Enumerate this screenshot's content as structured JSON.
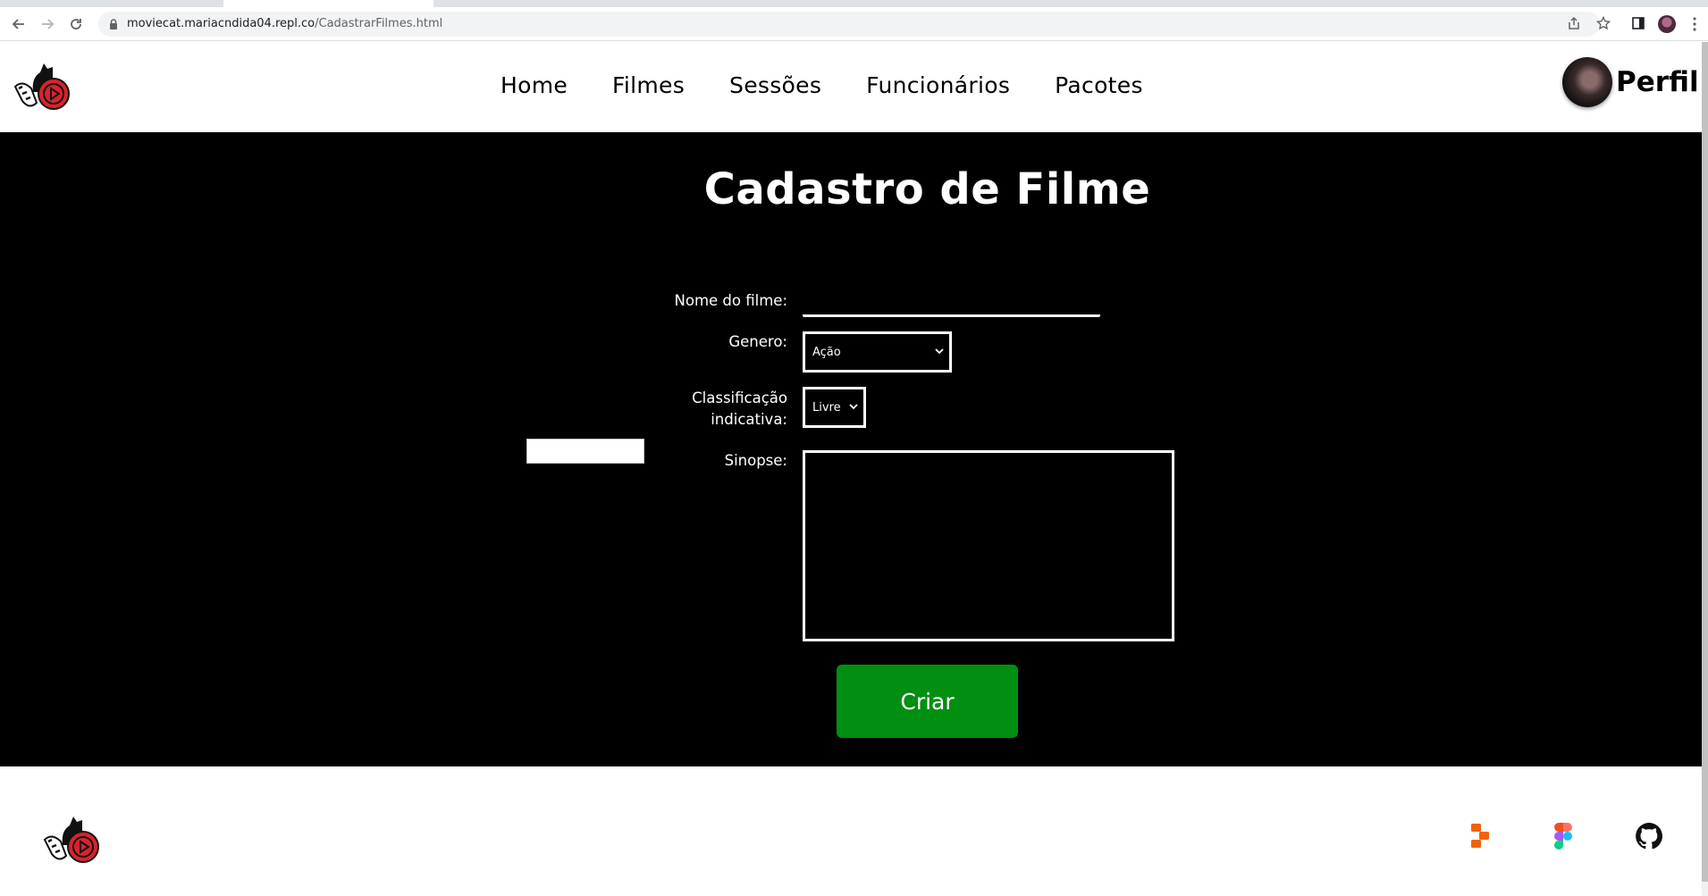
{
  "browser": {
    "url_host": "moviecat.mariacndida04.repl.co",
    "url_path": "/CadastrarFilmes.html"
  },
  "header": {
    "nav": [
      {
        "label": "Home"
      },
      {
        "label": "Filmes"
      },
      {
        "label": "Sessões"
      },
      {
        "label": "Funcionários"
      },
      {
        "label": "Pacotes"
      }
    ],
    "profile_label": "Perfil"
  },
  "form": {
    "title": "Cadastro de Filme",
    "name_label": "Nome do filme:",
    "name_value": "",
    "genre_label": "Genero:",
    "genre_selected": "Ação",
    "rating_label_line1": "Classificação",
    "rating_label_line2": "indicativa:",
    "rating_selected": "Livre",
    "synopsis_label": "Sinopse:",
    "synopsis_value": "",
    "submit_label": "Criar"
  },
  "colors": {
    "form_background": "#000000",
    "submit_button": "#008f11",
    "logo_red": "#d8232a",
    "replit_orange": "#f26207"
  },
  "footer": {
    "social": [
      "replit-icon",
      "figma-icon",
      "github-icon"
    ]
  }
}
